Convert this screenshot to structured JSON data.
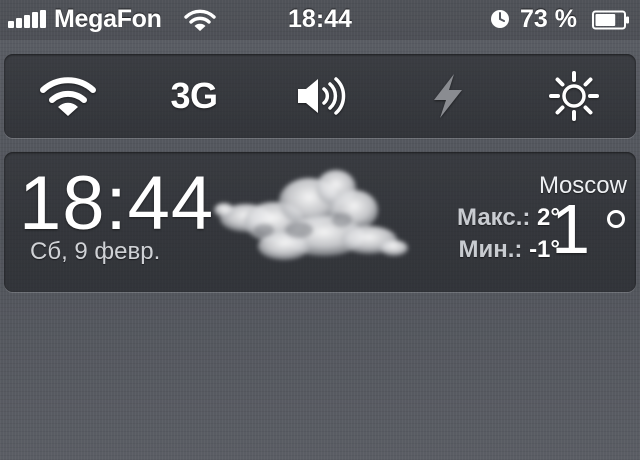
{
  "status_bar": {
    "signal_bars": 5,
    "carrier": "MegaFon",
    "wifi_icon": "wifi-icon",
    "time": "18:44",
    "alarm_icon": "alarm-clock-icon",
    "battery_percent": "73 %",
    "battery_level": 0.73
  },
  "toggles": [
    {
      "name": "wifi",
      "icon": "wifi-icon",
      "state": "on"
    },
    {
      "name": "cellular",
      "label": "3G",
      "state": "on"
    },
    {
      "name": "sound",
      "icon": "speaker-icon",
      "state": "on"
    },
    {
      "name": "flash",
      "icon": "lightning-icon",
      "state": "off"
    },
    {
      "name": "brightness",
      "icon": "sun-icon",
      "state": "on"
    }
  ],
  "weather": {
    "time": "18:44",
    "date": "Сб, 9 февр.",
    "city": "Moscow",
    "max_label": "Макс.:",
    "max_value": "2°",
    "min_label": "Мин.:",
    "min_value": "-1°",
    "temperature": "1",
    "condition_icon": "cloud-icon"
  },
  "colors": {
    "text": "#ffffff",
    "disabled_toggle": "#8a8c91",
    "secondary_text": "#d0d2d6"
  }
}
